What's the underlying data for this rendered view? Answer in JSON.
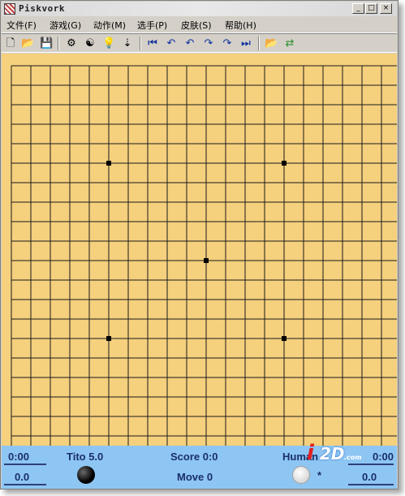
{
  "window": {
    "title": "Piskvork",
    "controls": {
      "minimize": "_",
      "maximize": "□",
      "close": "×"
    }
  },
  "menu": {
    "items": [
      "文件(F)",
      "游戏(G)",
      "动作(M)",
      "选手(P)",
      "皮肤(S)",
      "帮助(H)"
    ]
  },
  "toolbar": {
    "buttons": [
      {
        "name": "new",
        "glyph": "🗋"
      },
      {
        "name": "open",
        "glyph": "📂"
      },
      {
        "name": "save",
        "glyph": "💾"
      },
      {
        "name": "settings",
        "glyph": "⚙"
      },
      {
        "name": "engine",
        "glyph": "☯"
      },
      {
        "name": "hint",
        "glyph": "💡"
      },
      {
        "name": "sort",
        "glyph": "⇣"
      },
      {
        "name": "first-move",
        "glyph": "⏮"
      },
      {
        "name": "undo",
        "glyph": "↶"
      },
      {
        "name": "undo-one",
        "glyph": "↶"
      },
      {
        "name": "redo-one",
        "glyph": "↷"
      },
      {
        "name": "redo",
        "glyph": "↷"
      },
      {
        "name": "last-move",
        "glyph": "⏭"
      },
      {
        "name": "load-player",
        "glyph": "📂"
      },
      {
        "name": "swap-player",
        "glyph": "⇄"
      }
    ]
  },
  "board": {
    "size": 20,
    "star_points": [
      [
        5,
        5
      ],
      [
        5,
        14
      ],
      [
        10,
        10
      ],
      [
        14,
        5
      ],
      [
        14,
        14
      ]
    ],
    "colors": {
      "background": "#f5d07d",
      "lines": "#1a1a1a"
    }
  },
  "status": {
    "left_time": "0:00",
    "left_score": "0.0",
    "player1": "Tito 5.0",
    "score": "Score 0:0",
    "move": "Move 0",
    "player2": "Human",
    "turn_marker": "*",
    "right_time": "0:00",
    "right_score": "0.0",
    "colors": {
      "background": "#8ec6f3",
      "text": "#1a2f6a"
    }
  },
  "watermark": {
    "text": "2D",
    "sub": ".com"
  }
}
